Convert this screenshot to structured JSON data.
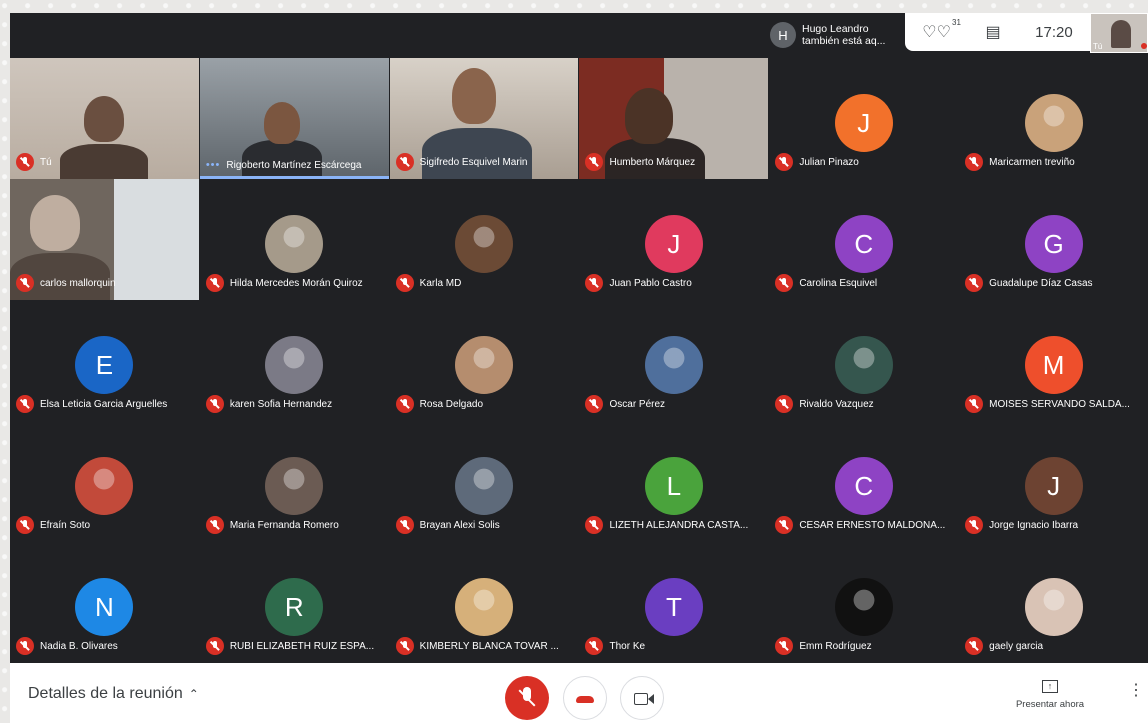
{
  "notification": {
    "initial": "H",
    "line1": "Hugo Leandro",
    "line2": "también está aq..."
  },
  "topbar": {
    "participants_count": "31",
    "clock": "17:20",
    "self_label": "Tú"
  },
  "tiles": [
    {
      "name": "Tú",
      "type": "video"
    },
    {
      "name": "Rigoberto Martínez Escárcega",
      "type": "video",
      "speaking": true
    },
    {
      "name": "Sigifredo Esquivel Marin",
      "type": "video"
    },
    {
      "name": "Humberto Márquez",
      "type": "video"
    },
    {
      "name": "Julian Pinazo",
      "type": "avatar",
      "initial": "J",
      "color": "#f2712b"
    },
    {
      "name": "Maricarmen treviño",
      "type": "photo",
      "color": "#c9a27a"
    },
    {
      "name": "carlos mallorquin",
      "type": "video"
    },
    {
      "name": "Hilda Mercedes Morán Quiroz",
      "type": "photo",
      "color": "#a59a8a"
    },
    {
      "name": "Karla MD",
      "type": "photo",
      "color": "#6b4a35"
    },
    {
      "name": "Juan Pablo Castro",
      "type": "avatar",
      "initial": "J",
      "color": "#e03a5e"
    },
    {
      "name": "Carolina Esquivel",
      "type": "avatar",
      "initial": "C",
      "color": "#8e43c4"
    },
    {
      "name": "Guadalupe Díaz Casas",
      "type": "avatar",
      "initial": "G",
      "color": "#8e43c4"
    },
    {
      "name": "Elsa Leticia Garcia Arguelles",
      "type": "avatar",
      "initial": "E",
      "color": "#1a66c6"
    },
    {
      "name": "karen Sofia Hernandez",
      "type": "photo",
      "color": "#7b7a86"
    },
    {
      "name": "Rosa Delgado",
      "type": "photo",
      "color": "#b58d6e"
    },
    {
      "name": "Oscar Pérez",
      "type": "photo",
      "color": "#4f6f9c"
    },
    {
      "name": "Rivaldo Vazquez",
      "type": "photo",
      "color": "#35564e"
    },
    {
      "name": "MOISES SERVANDO SALDA...",
      "type": "avatar",
      "initial": "M",
      "color": "#ee4f2c"
    },
    {
      "name": "Efraín Soto",
      "type": "photo",
      "color": "#c24a3a"
    },
    {
      "name": "Maria Fernanda Romero",
      "type": "photo",
      "color": "#6b5b53"
    },
    {
      "name": "Brayan Alexi Solis",
      "type": "photo",
      "color": "#5e6a7a"
    },
    {
      "name": "LIZETH ALEJANDRA CASTA...",
      "type": "avatar",
      "initial": "L",
      "color": "#4aa33c"
    },
    {
      "name": "CESAR ERNESTO MALDONA...",
      "type": "avatar",
      "initial": "C",
      "color": "#8e43c4"
    },
    {
      "name": "Jorge Ignacio Ibarra",
      "type": "avatar",
      "initial": "J",
      "color": "#6d4332"
    },
    {
      "name": "Nadia B. Olivares",
      "type": "avatar",
      "initial": "N",
      "color": "#1e88e5"
    },
    {
      "name": "RUBI ELIZABETH RUIZ ESPA...",
      "type": "avatar",
      "initial": "R",
      "color": "#2e6b4c"
    },
    {
      "name": "KIMBERLY BLANCA TOVAR ...",
      "type": "photo",
      "color": "#d6b07a"
    },
    {
      "name": "Thor Ke",
      "type": "avatar",
      "initial": "T",
      "color": "#6a3ec1"
    },
    {
      "name": "Emm Rodríguez",
      "type": "photo",
      "color": "#111111"
    },
    {
      "name": "gaely garcia",
      "type": "photo",
      "color": "#d9c3b5"
    }
  ],
  "bottombar": {
    "details_label": "Detalles de la reunión",
    "present_label": "Presentar ahora"
  }
}
